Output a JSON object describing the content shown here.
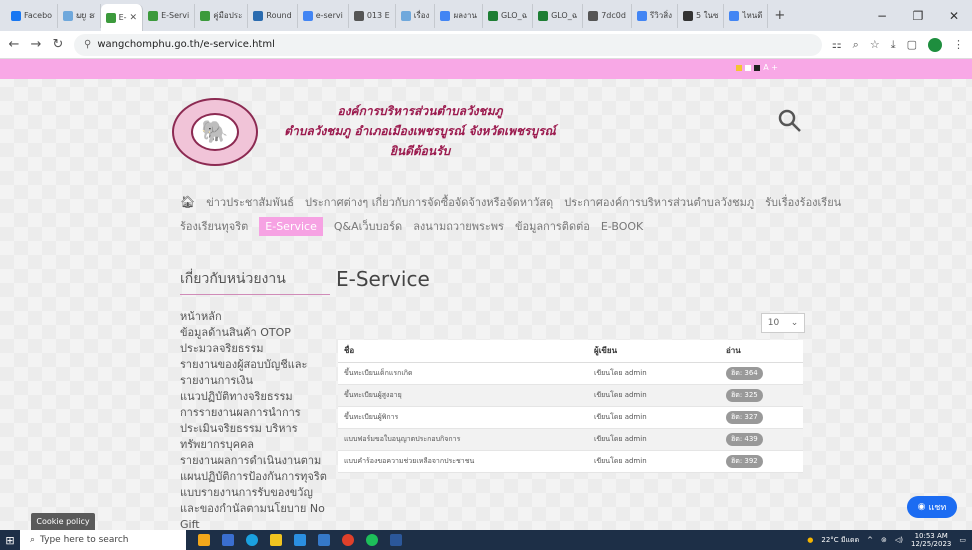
{
  "browser": {
    "tabs": [
      {
        "label": "Facebo",
        "color": "#1877f2",
        "active": false
      },
      {
        "label": "ພບູ ຮ",
        "color": "#6fa8dc",
        "active": false
      },
      {
        "label": "E-",
        "color": "#3c9a3c",
        "active": true
      },
      {
        "label": "E-Servi",
        "color": "#3c9a3c",
        "active": false
      },
      {
        "label": "คู่มือประ",
        "color": "#3c9a3c",
        "active": false
      },
      {
        "label": "Round",
        "color": "#2b6cb0",
        "active": false
      },
      {
        "label": "e-servi",
        "color": "#4285f4",
        "active": false
      },
      {
        "label": "013 E",
        "color": "#555555",
        "active": false
      },
      {
        "label": "เรื่อง",
        "color": "#6fa8dc",
        "active": false
      },
      {
        "label": "ผลงาน",
        "color": "#4285f4",
        "active": false
      },
      {
        "label": "GLO_ฉ",
        "color": "#1e7e34",
        "active": false
      },
      {
        "label": "GLO_ฉ",
        "color": "#1e7e34",
        "active": false
      },
      {
        "label": "7dc0d",
        "color": "#555555",
        "active": false
      },
      {
        "label": "รีวิวสิ่ง",
        "color": "#4285f4",
        "active": false
      },
      {
        "label": "5 ในซ",
        "color": "#333333",
        "active": false
      },
      {
        "label": "ไหนดี",
        "color": "#4285f4",
        "active": false
      }
    ],
    "new_tab": "+",
    "url": "wangchomphu.go.th/e-service.html"
  },
  "site": {
    "accessibility_text": "A  +",
    "org_line1": "องค์การบริหารส่วนตำบลวังชมภู",
    "org_line2": "ตำบลวังชมภู  อำเภอเมืองเพชรบูรณ์  จังหวัดเพชรบูรณ์",
    "org_line3": "ยินดีต้อนรับ",
    "menu_row1": [
      "ข่าวประชาสัมพันธ์",
      "ประกาศต่างๆ เกี่ยวกับการจัดซื้อจัดจ้างหรือจัดหาวัสดุ",
      "ประกาศองค์การบริหารส่วนตำบลวังชมภู",
      "รับเรื่องร้องเรียน"
    ],
    "menu_row2": [
      "ร้องเรียนทุจริต",
      "E-Service",
      "Q&Aเว็บบอร์ด",
      "ลงนามถวายพระพร",
      "ข้อมูลการติดต่อ",
      "E-BOOK"
    ],
    "sidebar_title": "เกี่ยวกับหน่วยงาน",
    "sidebar_links": [
      "หน้าหลัก",
      "ข้อมูลด้านสินค้า OTOP",
      "ประมวลจริยธรรม",
      "รายงานของผู้สอบบัญชีและรายงานการเงิน",
      "แนวปฏิบัติทางจริยธรรม",
      "การรายงานผลการนำการประเมินจริยธรรม บริหารทรัพยากรบุคคล",
      "รายงานผลการดำเนินงานตามแผนปฏิบัติการป้องกันการทุจริต",
      "แบบรายงานการรับของขวัญและของกำนัลตามนโยบาย No Gift"
    ],
    "main_title": "E-Service",
    "per_page": "10",
    "table_headers": [
      "ชื่อ",
      "ผู้เขียน",
      "อ่าน"
    ],
    "rows": [
      {
        "name": "ขึ้นทะเบียนเด็กแรกเกิด",
        "author": "เขียนโดย admin",
        "views": "ฮิต: 364"
      },
      {
        "name": "ขึ้นทะเบียนผู้สูงอายุ",
        "author": "เขียนโดย admin",
        "views": "ฮิต: 325"
      },
      {
        "name": "ขึ้นทะเบียนผู้พิการ",
        "author": "เขียนโดย admin",
        "views": "ฮิต: 327"
      },
      {
        "name": "แบบฟอร์มขอใบอนุญาตประกอบกิจการ",
        "author": "เขียนโดย admin",
        "views": "ฮิต: 439"
      },
      {
        "name": "แบบคำร้องขอความช่วยเหลือจากประชาชน",
        "author": "เขียนโดย admin",
        "views": "ฮิต: 392"
      }
    ],
    "cookie_label": "Cookie policy",
    "chat_label": "แชท"
  },
  "taskbar": {
    "search_placeholder": "Type here to search",
    "weather": "22°C มีแดด",
    "time": "10:53 AM",
    "date": "12/25/2023"
  }
}
